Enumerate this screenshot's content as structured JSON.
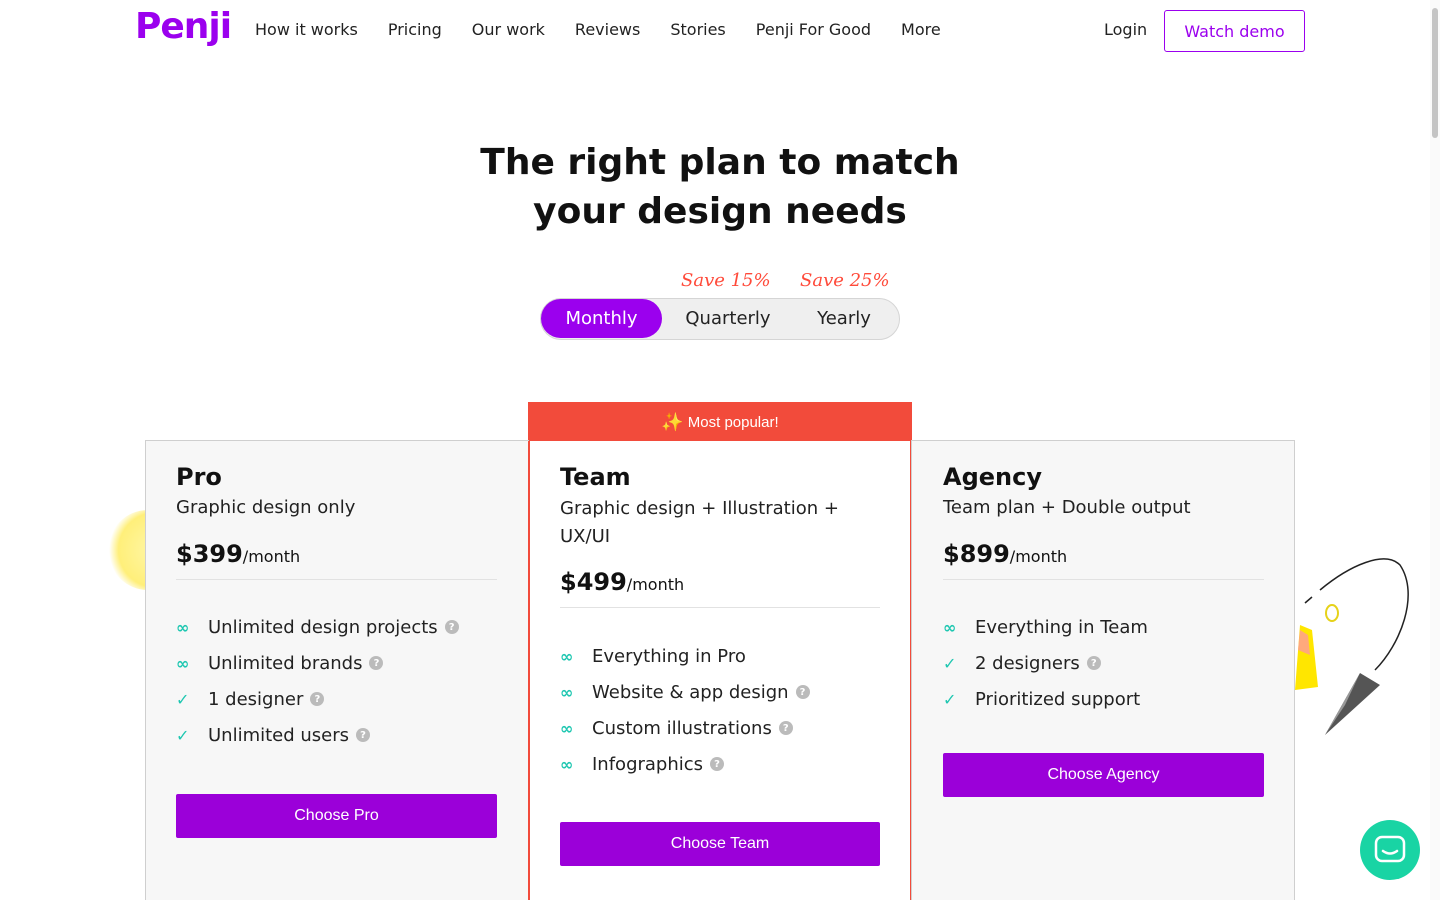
{
  "nav": {
    "logo": "Penji",
    "links": [
      "How it works",
      "Pricing",
      "Our work",
      "Reviews",
      "Stories",
      "Penji For Good",
      "More"
    ],
    "login": "Login",
    "watch_demo": "Watch demo"
  },
  "hero": {
    "title_line1": "The right plan to match",
    "title_line2": "your design needs"
  },
  "billing": {
    "options": [
      "Monthly",
      "Quarterly",
      "Yearly"
    ],
    "selected": "Monthly",
    "save_quarterly": "Save 15%",
    "save_yearly": "Save 25%"
  },
  "colors": {
    "brand_purple": "#9b00ee",
    "popular_red": "#f24b3b",
    "accent_teal": "#1fc7b1"
  },
  "plans": {
    "pro": {
      "name": "Pro",
      "desc": "Graphic design only",
      "price": "$399",
      "per": "/month",
      "features": [
        {
          "text": "Unlimited design projects",
          "icon": "infinity-icon",
          "help": true
        },
        {
          "text": "Unlimited brands",
          "icon": "infinity-icon",
          "help": true
        },
        {
          "text": "1 designer",
          "icon": "check-icon",
          "help": true
        },
        {
          "text": "Unlimited users",
          "icon": "check-icon",
          "help": true
        }
      ],
      "cta": "Choose Pro"
    },
    "team": {
      "badge": "Most popular!",
      "name": "Team",
      "desc_line1": "Graphic design + Illustration +",
      "desc_line2": "UX/UI",
      "price": "$499",
      "per": "/month",
      "features": [
        {
          "text": "Everything in Pro",
          "icon": "infinity-icon",
          "help": false
        },
        {
          "text": "Website & app design",
          "icon": "infinity-icon",
          "help": true
        },
        {
          "text": "Custom illustrations",
          "icon": "infinity-icon",
          "help": true
        },
        {
          "text": "Infographics",
          "icon": "infinity-icon",
          "help": true
        }
      ],
      "cta": "Choose Team"
    },
    "agency": {
      "name": "Agency",
      "desc": "Team plan + Double output",
      "price": "$899",
      "per": "/month",
      "features": [
        {
          "text": "Everything in Team",
          "icon": "infinity-icon",
          "help": false
        },
        {
          "text": "2 designers",
          "icon": "check-icon",
          "help": true
        },
        {
          "text": "Prioritized support",
          "icon": "check-icon",
          "help": false
        }
      ],
      "cta": "Choose Agency"
    }
  }
}
